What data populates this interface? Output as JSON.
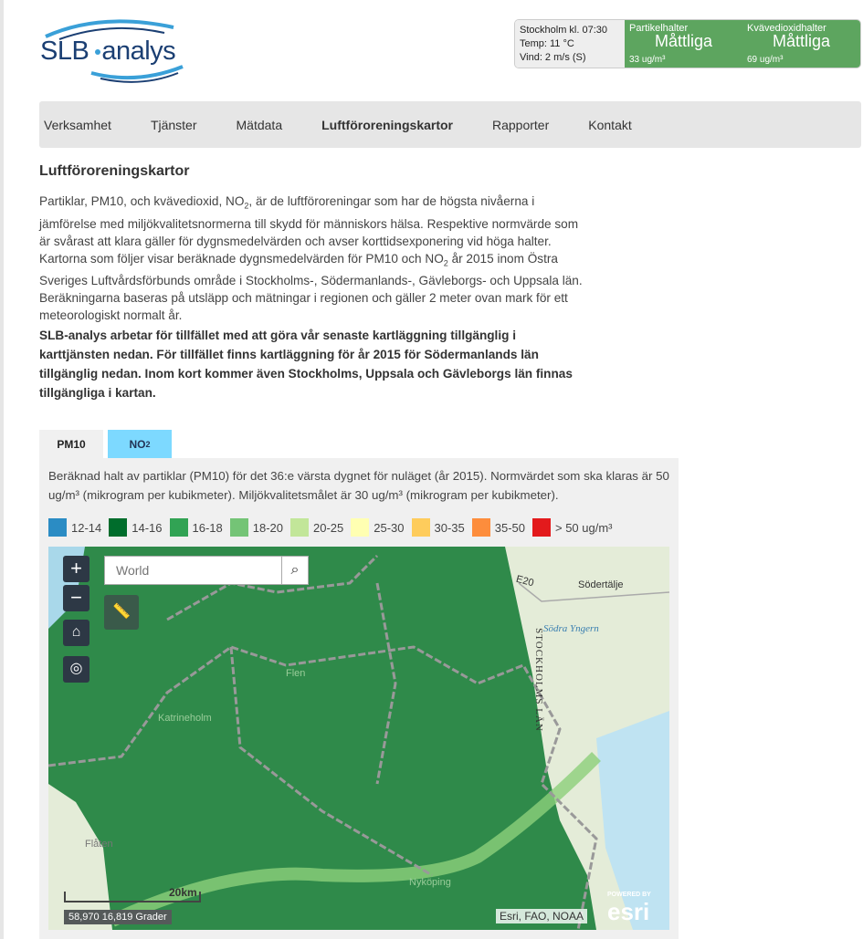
{
  "logo": {
    "text_left": "SLB",
    "text_right": "analys"
  },
  "weather": {
    "line1": "Stockholm kl. 07:30",
    "line2": "Temp: 11 °C",
    "line3": "Vind: 2 m/s (S)"
  },
  "air_quality": [
    {
      "label": "Partikelhalter",
      "status": "Måttliga",
      "value": "33 ug/m³"
    },
    {
      "label": "Kvävedioxidhalter",
      "status": "Måttliga",
      "value": "69 ug/m³"
    }
  ],
  "air_quality_color": "#5da55f",
  "nav": {
    "items": [
      "Verksamhet",
      "Tjänster",
      "Mätdata",
      "Luftföroreningskartor",
      "Rapporter",
      "Kontakt"
    ],
    "active": "Luftföroreningskartor"
  },
  "page_title": "Luftföroreningskartor",
  "intro": {
    "a": "Partiklar, PM10, och kvävedioxid, NO",
    "sub1": "2",
    "b": ", är de luftföroreningar som har de högsta nivåerna i jämförelse med miljökvalitetsnormerna till skydd för människors hälsa. Respektive normvärde som är svårast att klara gäller för dygnsmedelvärden och avser korttidsexponering vid höga halter. Kartorna som följer visar beräknade dygnsmedelvärden för PM10 och NO",
    "sub2": "2",
    "c": " år 2015 inom Östra Sveriges Luftvårdsförbunds område i Stockholms-, Södermanlands-, Gävleborgs- och Uppsala län. Beräkningarna baseras på utsläpp och mätningar i regionen och gäller 2 meter ovan mark för ett meteorologiskt normalt år."
  },
  "notice": "SLB-analys arbetar för tillfället med att göra vår senaste kartläggning tillgänglig i karttjänsten nedan. För tillfället finns kartläggning för år 2015 för Södermanlands län tillgänglig nedan. Inom kort kommer även Stockholms, Uppsala och Gävleborgs län finnas tillgängliga i kartan.",
  "tabs": [
    {
      "label": "PM10",
      "active": true
    },
    {
      "label": "NO",
      "sub": "2",
      "active": false
    }
  ],
  "description": "Beräknad halt av partiklar (PM10) för det 36:e värsta dygnet för nuläget (år 2015). Normvärdet som ska klaras är 50 ug/m³ (mikrogram per kubikmeter). Miljökvalitetsmålet är 30 ug/m³ (mikrogram per kubikmeter).",
  "legend": [
    {
      "label": "12-14",
      "color": "#2b8cc4"
    },
    {
      "label": "14-16",
      "color": "#006d2c"
    },
    {
      "label": "16-18",
      "color": "#31a354"
    },
    {
      "label": "18-20",
      "color": "#74c476"
    },
    {
      "label": "20-25",
      "color": "#c2e699"
    },
    {
      "label": "25-30",
      "color": "#ffffb2"
    },
    {
      "label": "30-35",
      "color": "#fecc5c"
    },
    {
      "label": "35-50",
      "color": "#fd8d3c"
    },
    {
      "label": "> 50 ug/m³",
      "color": "#e31a1c"
    }
  ],
  "map": {
    "search_placeholder": "World",
    "labels": [
      "Södertälje",
      "E20",
      "STOCKHOLMS LÄN",
      "Södra Yngern",
      "Katrineholm",
      "Flen",
      "Flåten",
      "Nyköping"
    ],
    "scale": "20km",
    "coordinates": "58,970 16,819 Grader",
    "attribution": "Esri, FAO, NOAA",
    "powered_by": "POWERED BY",
    "esri": "esri"
  }
}
